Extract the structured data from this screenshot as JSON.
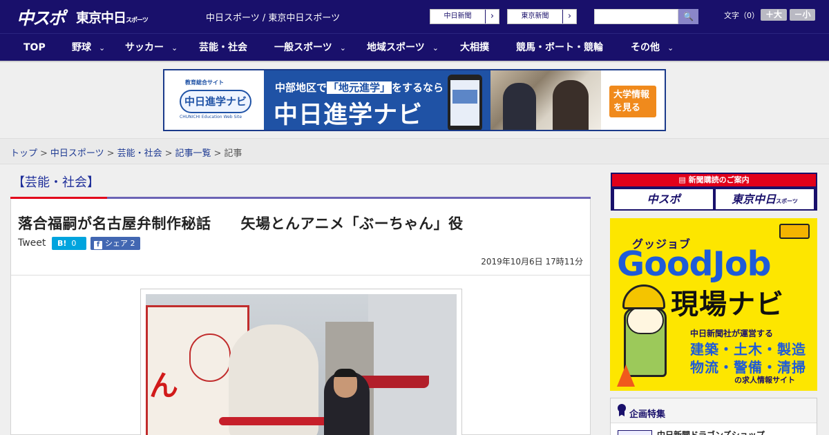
{
  "header": {
    "logo_main": "中スポ",
    "logo_tokyo": "東京中日",
    "logo_tokyo_small": "スポーツ",
    "site_link": "中日スポーツ / 東京中日スポーツ",
    "external_links": [
      {
        "label": "中日新聞",
        "arrow": "›"
      },
      {
        "label": "東京新聞",
        "arrow": "›"
      }
    ],
    "search": {
      "placeholder": "",
      "button": "🔍"
    },
    "font_size": {
      "label": "文字（0）",
      "larger": "＋大",
      "smaller": "－小"
    }
  },
  "nav": {
    "items": [
      {
        "label": "TOP",
        "chevron": ""
      },
      {
        "label": "野球",
        "chevron": "⌄"
      },
      {
        "label": "サッカー",
        "chevron": "⌄"
      },
      {
        "label": "芸能・社会",
        "chevron": ""
      },
      {
        "label": "一般スポーツ",
        "chevron": "⌄"
      },
      {
        "label": "地域スポーツ",
        "chevron": "⌄"
      },
      {
        "label": "大相撲",
        "chevron": ""
      },
      {
        "label": "競馬・ボート・競輪",
        "chevron": ""
      },
      {
        "label": "その他",
        "chevron": "⌄"
      }
    ]
  },
  "banner": {
    "site_tag": "教育総合サイト",
    "logo_text": "中日進学ナビ",
    "logo_en": "CHUNICHI Education Web Site",
    "tagline_pre": "中部地区で",
    "tagline_hl": "「地元進学」",
    "tagline_post": "をするなら",
    "title": "中日進学ナビ",
    "cta_line1": "大学情報",
    "cta_line2": "を見る"
  },
  "breadcrumb": {
    "items": [
      "トップ",
      "中日スポーツ",
      "芸能・社会",
      "記事一覧"
    ],
    "current": "記事",
    "separator": ">"
  },
  "section": {
    "title": "【芸能・社会】"
  },
  "article": {
    "headline": "落合福嗣が名古屋弁制作秘話　　矢場とんアニメ「ぶーちゃん」役",
    "tweet": "Tweet",
    "hatena_label": "B!",
    "hatena_count": "0",
    "fb_glyph": "f",
    "fb_label": "シェア",
    "fb_count": "2",
    "timestamp": "2019年10月6日 17時11分"
  },
  "sidebar": {
    "subscription": {
      "heading": "新聞購読のご案内",
      "chuspo": "中スポ",
      "tokyo": "東京中日",
      "tokyo_small": "スポーツ"
    },
    "goodjob": {
      "kana": "グッジョブ",
      "title": "GoodJob",
      "big": "現場ナビ",
      "lead": "中日新聞社が運営する",
      "line1": "建築・土木・製造",
      "line2": "物流・警備・清掃",
      "foot": "の求人情報サイト"
    },
    "feature": {
      "title": "企画特集",
      "first_item": "中日新聞ドラゴンズショップ"
    }
  },
  "colors": {
    "brand_navy": "#19106b",
    "accent_red": "#e2001a",
    "section_purple": "#6b63b5",
    "goodjob_yellow": "#fde600"
  }
}
